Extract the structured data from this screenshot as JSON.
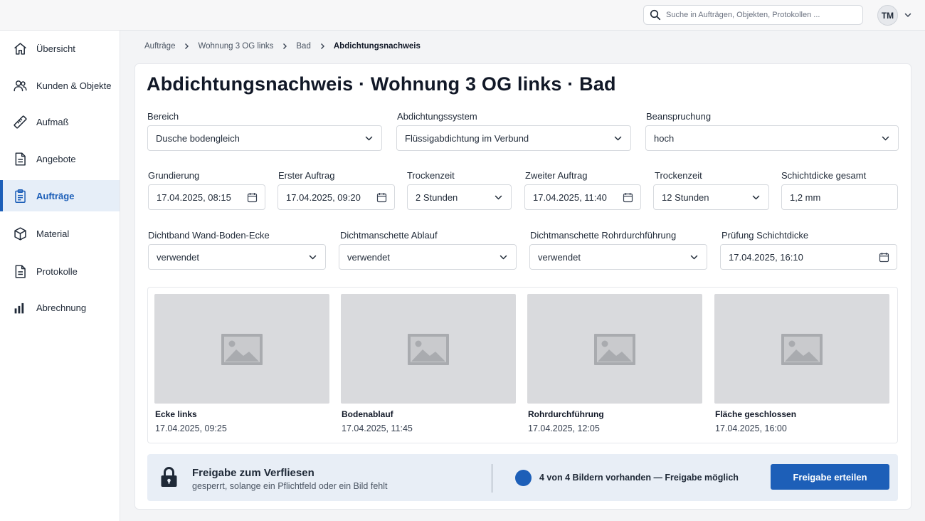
{
  "header": {
    "search_placeholder": "Suche in Aufträgen, Objekten, Protokollen ...",
    "user_initials": "TM"
  },
  "sidebar": {
    "items": [
      {
        "label": "Übersicht",
        "icon": "home-icon"
      },
      {
        "label": "Kunden & Objekte",
        "icon": "users-icon"
      },
      {
        "label": "Aufmaß",
        "icon": "ruler-icon"
      },
      {
        "label": "Angebote",
        "icon": "document-icon"
      },
      {
        "label": "Aufträge",
        "icon": "clipboard-icon",
        "active": true
      },
      {
        "label": "Material",
        "icon": "box-icon"
      },
      {
        "label": "Protokolle",
        "icon": "document-icon"
      },
      {
        "label": "Abrechnung",
        "icon": "bar-chart-icon"
      }
    ]
  },
  "breadcrumb": [
    "Aufträge",
    "Wohnung 3 OG links",
    "Bad",
    "Abdichtungsnachweis"
  ],
  "page": {
    "title": "Abdichtungsnachweis · Wohnung 3 OG links · Bad"
  },
  "form": {
    "row1": [
      {
        "label": "Bereich",
        "value": "Dusche bodengleich",
        "type": "select"
      },
      {
        "label": "Abdichtungssystem",
        "value": "Flüssigabdichtung im Verbund",
        "type": "select"
      },
      {
        "label": "Beanspruchung",
        "value": "hoch",
        "type": "select"
      }
    ],
    "row2": [
      {
        "label": "Grundierung",
        "value": "17.04.2025, 08:15",
        "type": "datetime"
      },
      {
        "label": "Erster Auftrag",
        "value": "17.04.2025, 09:20",
        "type": "datetime"
      },
      {
        "label": "Trockenzeit",
        "value": "2 Stunden",
        "type": "select"
      },
      {
        "label": "Zweiter Auftrag",
        "value": "17.04.2025, 11:40",
        "type": "datetime"
      },
      {
        "label": "Trockenzeit",
        "value": "12 Stunden",
        "type": "select"
      },
      {
        "label": "Schichtdicke gesamt",
        "value": "1,2 mm",
        "type": "text"
      }
    ],
    "row3": [
      {
        "label": "Dichtband Wand-Boden-Ecke",
        "value": "verwendet",
        "type": "select"
      },
      {
        "label": "Dichtmanschette Ablauf",
        "value": "verwendet",
        "type": "select"
      },
      {
        "label": "Dichtmanschette Rohrdurchführung",
        "value": "verwendet",
        "type": "select"
      },
      {
        "label": "Prüfung Schichtdicke",
        "value": "17.04.2025, 16:10",
        "type": "datetime"
      }
    ]
  },
  "photos": [
    {
      "title": "Ecke links",
      "date": "17.04.2025, 09:25"
    },
    {
      "title": "Bodenablauf",
      "date": "17.04.2025, 11:45"
    },
    {
      "title": "Rohrdurchführung",
      "date": "17.04.2025, 12:05"
    },
    {
      "title": "Fläche geschlossen",
      "date": "17.04.2025, 16:00"
    }
  ],
  "release": {
    "title": "Freigabe zum Verfliesen",
    "subtitle": "gesperrt, solange ein Pflichtfeld oder ein Bild fehlt",
    "status": "4 von 4 Bildern vorhanden — Freigabe möglich",
    "button_label": "Freigabe erteilen"
  },
  "colors": {
    "accent": "#1d5fb8",
    "active_nav_bg": "#e6eef8",
    "photo_placeholder": "#d9dadd",
    "release_bg": "#e8eef6"
  }
}
